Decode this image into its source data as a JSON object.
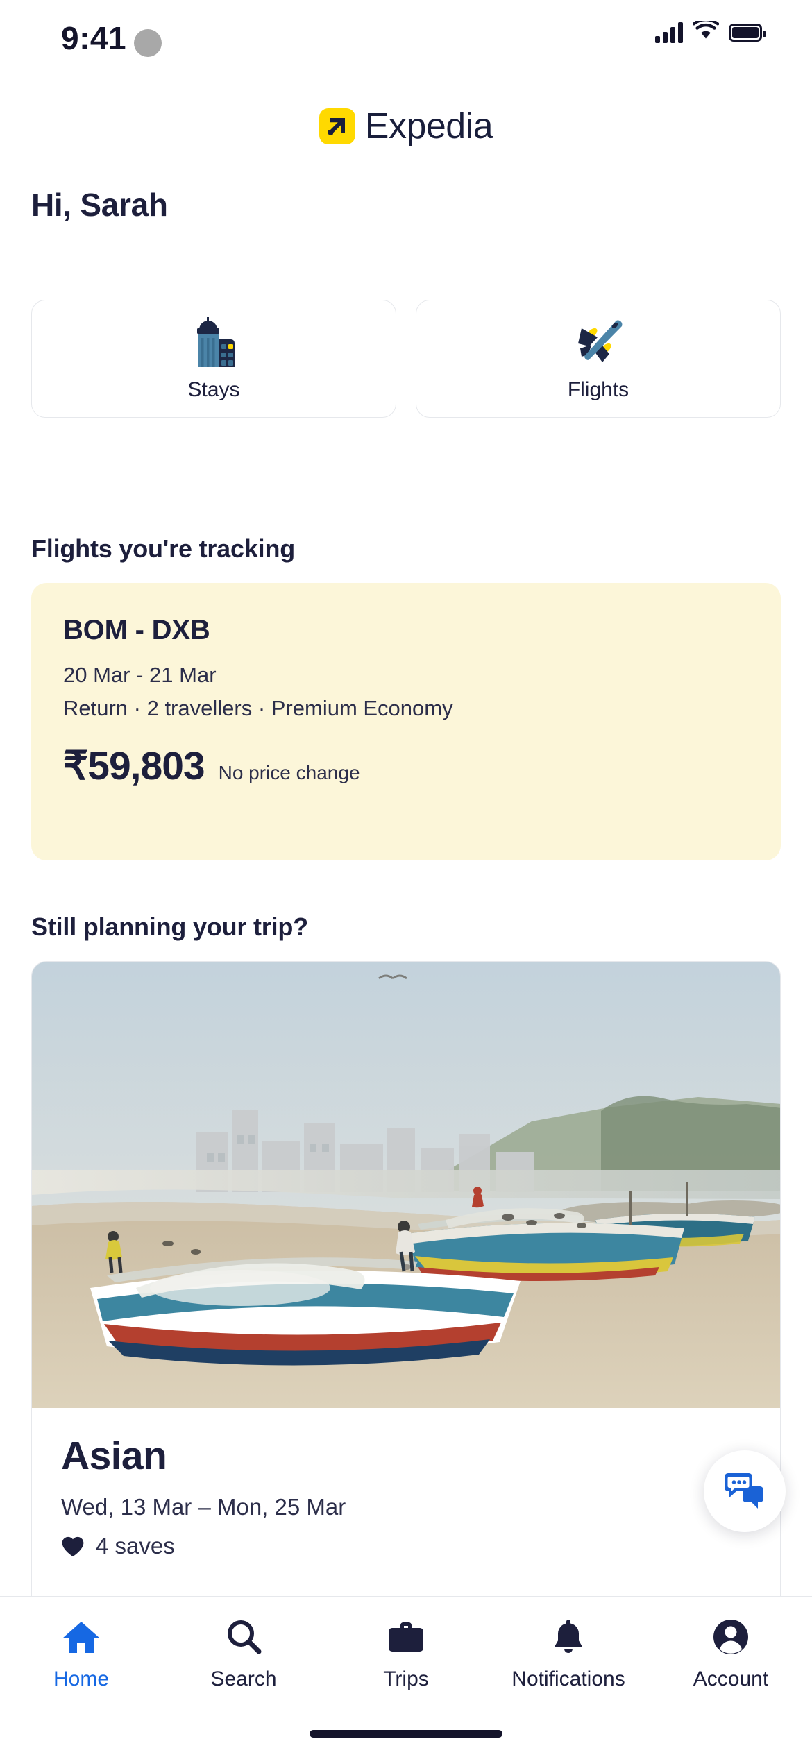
{
  "status_bar": {
    "time": "9:41",
    "icons": [
      "cellular-signal-icon",
      "wifi-icon",
      "battery-icon"
    ]
  },
  "brand": {
    "name": "Expedia",
    "mark_icon": "expedia-arrow-logo",
    "mark_color": "#ffd900",
    "text_color": "#191e3b"
  },
  "greeting": "Hi, Sarah",
  "quick_actions": [
    {
      "label": "Stays",
      "icon": "buildings-icon"
    },
    {
      "label": "Flights",
      "icon": "airplane-icon"
    }
  ],
  "tracking": {
    "heading": "Flights you're tracking",
    "card": {
      "route": "BOM - DXB",
      "dates": "20 Mar - 21 Mar",
      "details": "Return · 2 travellers · Premium Economy",
      "price": "₹59,803",
      "price_change": "No price change",
      "background_color": "#fcf6d9"
    }
  },
  "planning": {
    "heading": "Still planning your trip?",
    "trip": {
      "title": "Asian",
      "dates": "Wed, 13 Mar – Mon, 25 Mar",
      "saves": "4 saves",
      "saves_icon": "heart-filled-icon",
      "photo_alt": "fishing boats on a beach at sunrise"
    }
  },
  "chat_fab": {
    "icon": "chat-bubbles-icon",
    "color": "#1a62d6"
  },
  "bottom_nav": {
    "active_color": "#1668e3",
    "inactive_color": "#1d1f3c",
    "items": [
      {
        "label": "Home",
        "icon": "home-icon",
        "active": true
      },
      {
        "label": "Search",
        "icon": "search-icon",
        "active": false
      },
      {
        "label": "Trips",
        "icon": "briefcase-icon",
        "active": false
      },
      {
        "label": "Notifications",
        "icon": "bell-icon",
        "active": false
      },
      {
        "label": "Account",
        "icon": "person-circle-icon",
        "active": false
      }
    ]
  }
}
